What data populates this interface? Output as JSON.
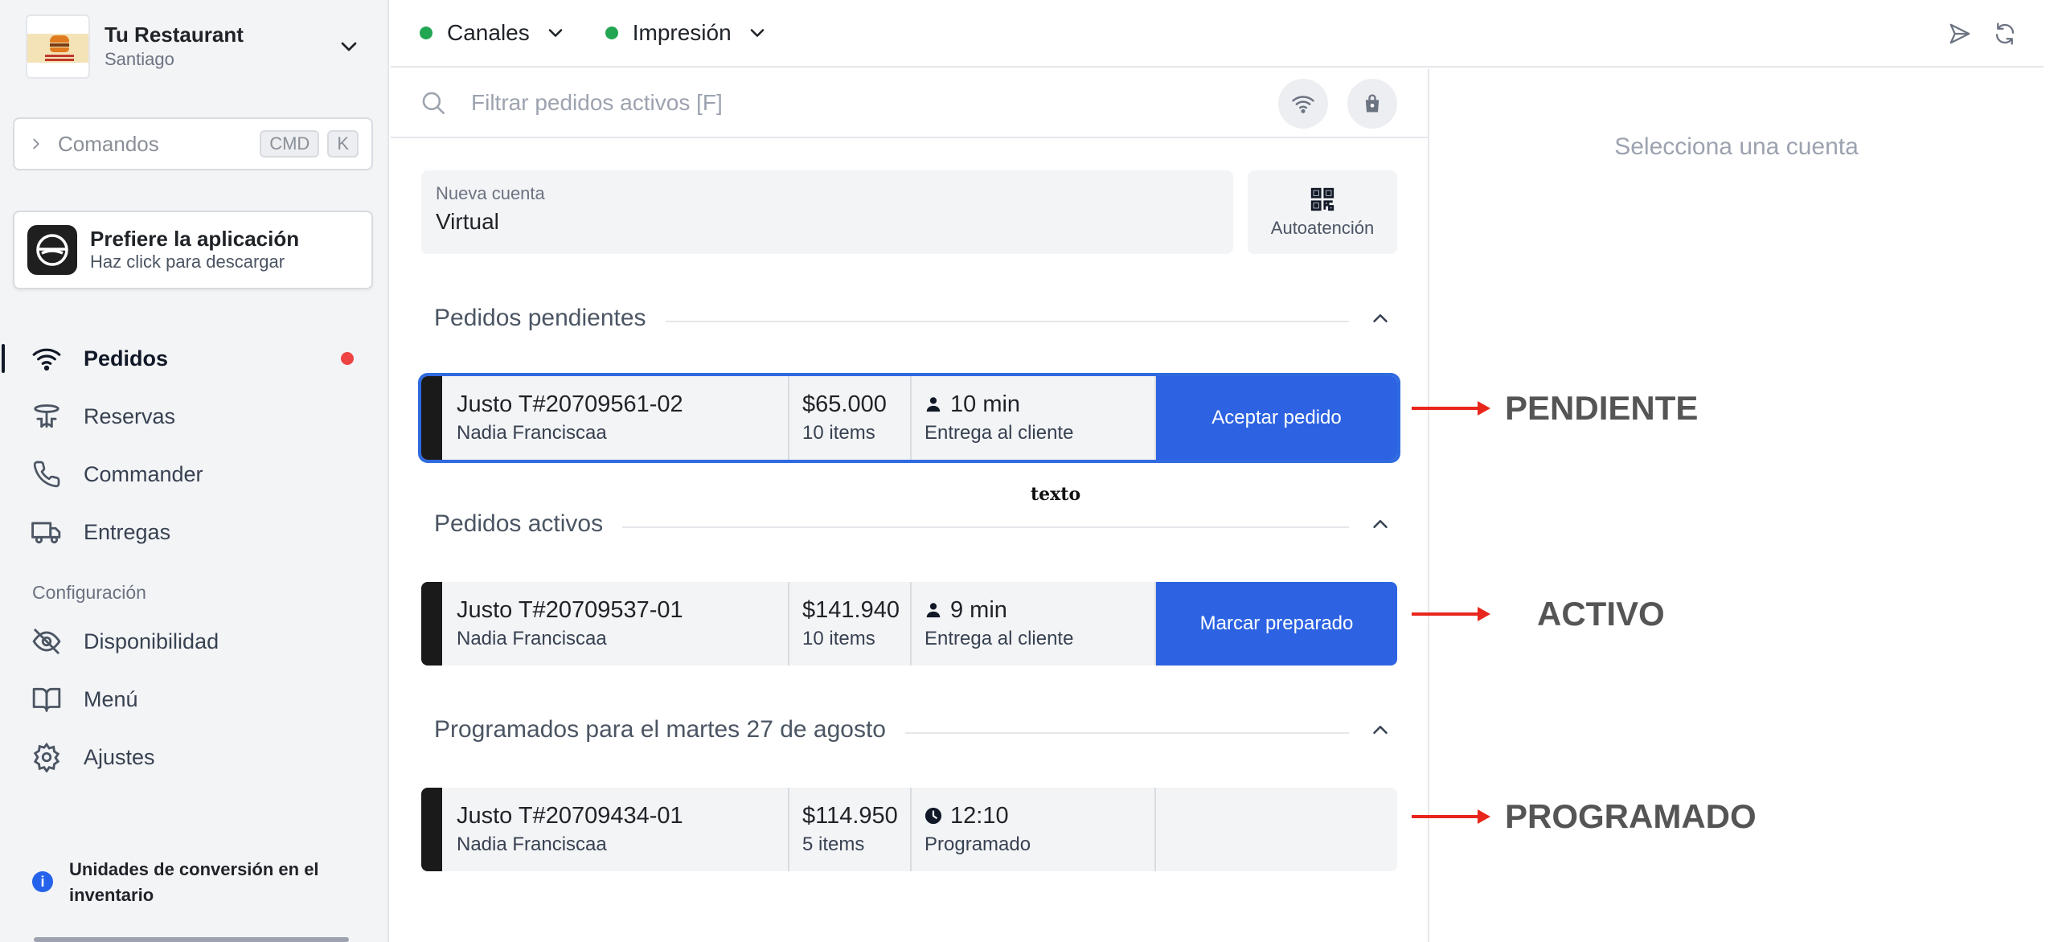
{
  "restaurant": {
    "name": "Tu Restaurant",
    "city": "Santiago"
  },
  "commands": {
    "label": "Comandos",
    "keys": [
      "CMD",
      "K"
    ]
  },
  "promo": {
    "title": "Prefiere la aplicación",
    "subtitle": "Haz click para descargar"
  },
  "nav": {
    "items": [
      {
        "label": "Pedidos",
        "icon": "wifi-icon",
        "active": true,
        "has_alert": true
      },
      {
        "label": "Reservas",
        "icon": "table-icon"
      },
      {
        "label": "Commander",
        "icon": "phone-icon"
      },
      {
        "label": "Entregas",
        "icon": "truck-icon"
      }
    ],
    "section_label": "Configuración",
    "config_items": [
      {
        "label": "Disponibilidad",
        "icon": "eye-off-icon"
      },
      {
        "label": "Menú",
        "icon": "book-icon"
      },
      {
        "label": "Ajustes",
        "icon": "gear-icon"
      }
    ]
  },
  "notice": {
    "text": "Unidades de conversión en el inventario"
  },
  "topbar": {
    "channels": [
      {
        "label": "Canales",
        "status_color": "#22a652"
      },
      {
        "label": "Impresión",
        "status_color": "#22a652"
      }
    ],
    "actions": [
      "send-icon",
      "refresh-icon"
    ]
  },
  "filter": {
    "placeholder": "Filtrar pedidos activos [F]"
  },
  "new_account": {
    "label": "Nueva cuenta",
    "value": "Virtual"
  },
  "self_service": {
    "label": "Autoatención"
  },
  "sections": {
    "pending": {
      "title": "Pedidos pendientes"
    },
    "active": {
      "title": "Pedidos activos"
    },
    "scheduled": {
      "title": "Programados para el martes 27 de agosto"
    }
  },
  "orders": {
    "pending": {
      "id": "Justo T#20709561-02",
      "customer": "Nadia Franciscaa",
      "amount": "$65.000",
      "items": "10 items",
      "time": "10 min",
      "mode": "Entrega al cliente",
      "action": "Aceptar pedido"
    },
    "active": {
      "id": "Justo T#20709537-01",
      "customer": "Nadia Franciscaa",
      "amount": "$141.940",
      "items": "10 items",
      "time": "9 min",
      "mode": "Entrega al cliente",
      "action": "Marcar preparado"
    },
    "scheduled": {
      "id": "Justo T#20709434-01",
      "customer": "Nadia Franciscaa",
      "amount": "$114.950",
      "items": "5 items",
      "time": "12:10",
      "mode": "Programado"
    }
  },
  "floating_text": "texto",
  "right_panel": {
    "placeholder": "Selecciona una cuenta"
  },
  "annotations": {
    "pending": "PENDIENTE",
    "active": "ACTIVO",
    "scheduled": "PROGRAMADO"
  },
  "colors": {
    "accent": "#2d63e2",
    "alert": "#ef4444",
    "status_ok": "#22a652",
    "arrow": "#e8261c"
  }
}
